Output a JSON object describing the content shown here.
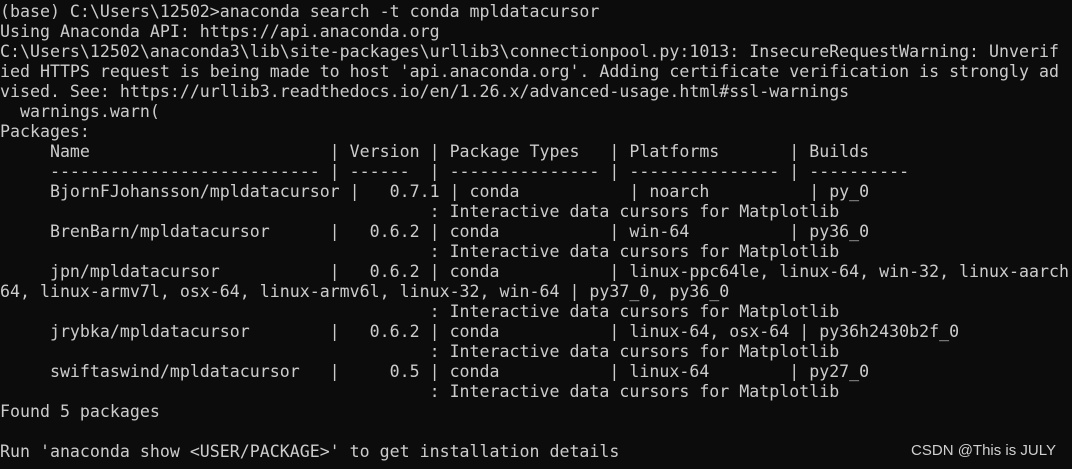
{
  "terminal": {
    "background": "#0c0c0c",
    "foreground": "#cccccc",
    "lines": [
      "(base) C:\\Users\\12502>anaconda search -t conda mpldatacursor",
      "Using Anaconda API: https://api.anaconda.org",
      "C:\\Users\\12502\\anaconda3\\lib\\site-packages\\urllib3\\connectionpool.py:1013: InsecureRequestWarning: Unverif",
      "ied HTTPS request is being made to host 'api.anaconda.org'. Adding certificate verification is strongly ad",
      "vised. See: https://urllib3.readthedocs.io/en/1.26.x/advanced-usage.html#ssl-warnings",
      "  warnings.warn(",
      "Packages:",
      "     Name                        | Version | Package Types   | Platforms       | Builds",
      "     --------------------------- | ------  | --------------- | --------------- | ----------",
      "     BjornFJohansson/mpldatacursor |   0.7.1 | conda           | noarch          | py_0",
      "                                           : Interactive data cursors for Matplotlib",
      "     BrenBarn/mpldatacursor      |   0.6.2 | conda           | win-64          | py36_0",
      "                                           : Interactive data cursors for Matplotlib",
      "     jpn/mpldatacursor           |   0.6.2 | conda           | linux-ppc64le, linux-64, win-32, linux-aarch",
      "64, linux-armv7l, osx-64, linux-armv6l, linux-32, win-64 | py37_0, py36_0",
      "                                           : Interactive data cursors for Matplotlib",
      "     jrybka/mpldatacursor        |   0.6.2 | conda           | linux-64, osx-64 | py36h2430b2f_0",
      "                                           : Interactive data cursors for Matplotlib",
      "     swiftaswind/mpldatacursor   |     0.5 | conda           | linux-64        | py27_0",
      "                                           : Interactive data cursors for Matplotlib",
      "Found 5 packages",
      "",
      "Run 'anaconda show <USER/PACKAGE>' to get installation details"
    ]
  },
  "watermark": {
    "text": "CSDN @This is JULY"
  }
}
